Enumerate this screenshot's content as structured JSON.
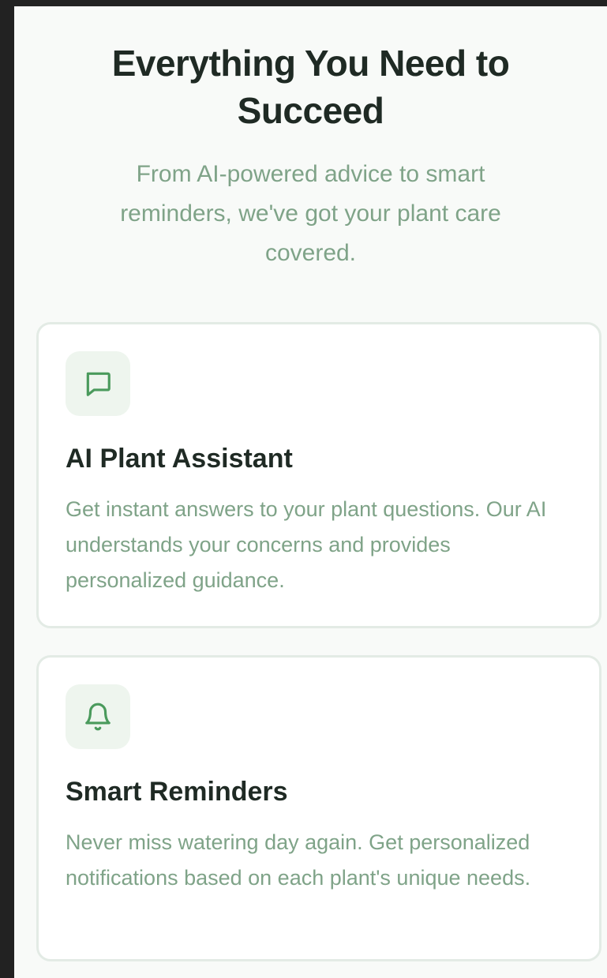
{
  "section": {
    "title": "Everything You Need to Succeed",
    "subtitle": "From AI-powered advice to smart reminders, we've got your plant care covered."
  },
  "features": [
    {
      "icon": "message-icon",
      "title": "AI Plant Assistant",
      "description": "Get instant answers to your plant questions. Our AI understands your concerns and provides personalized guidance."
    },
    {
      "icon": "bell-icon",
      "title": "Smart Reminders",
      "description": "Never miss watering day again. Get personalized notifications based on each plant's unique needs."
    }
  ],
  "colors": {
    "accent": "#4a9a5c",
    "title": "#1f2a24",
    "muted_text": "#7fa388",
    "icon_bg": "#eef5ee",
    "card_border": "#e3ebe5"
  }
}
